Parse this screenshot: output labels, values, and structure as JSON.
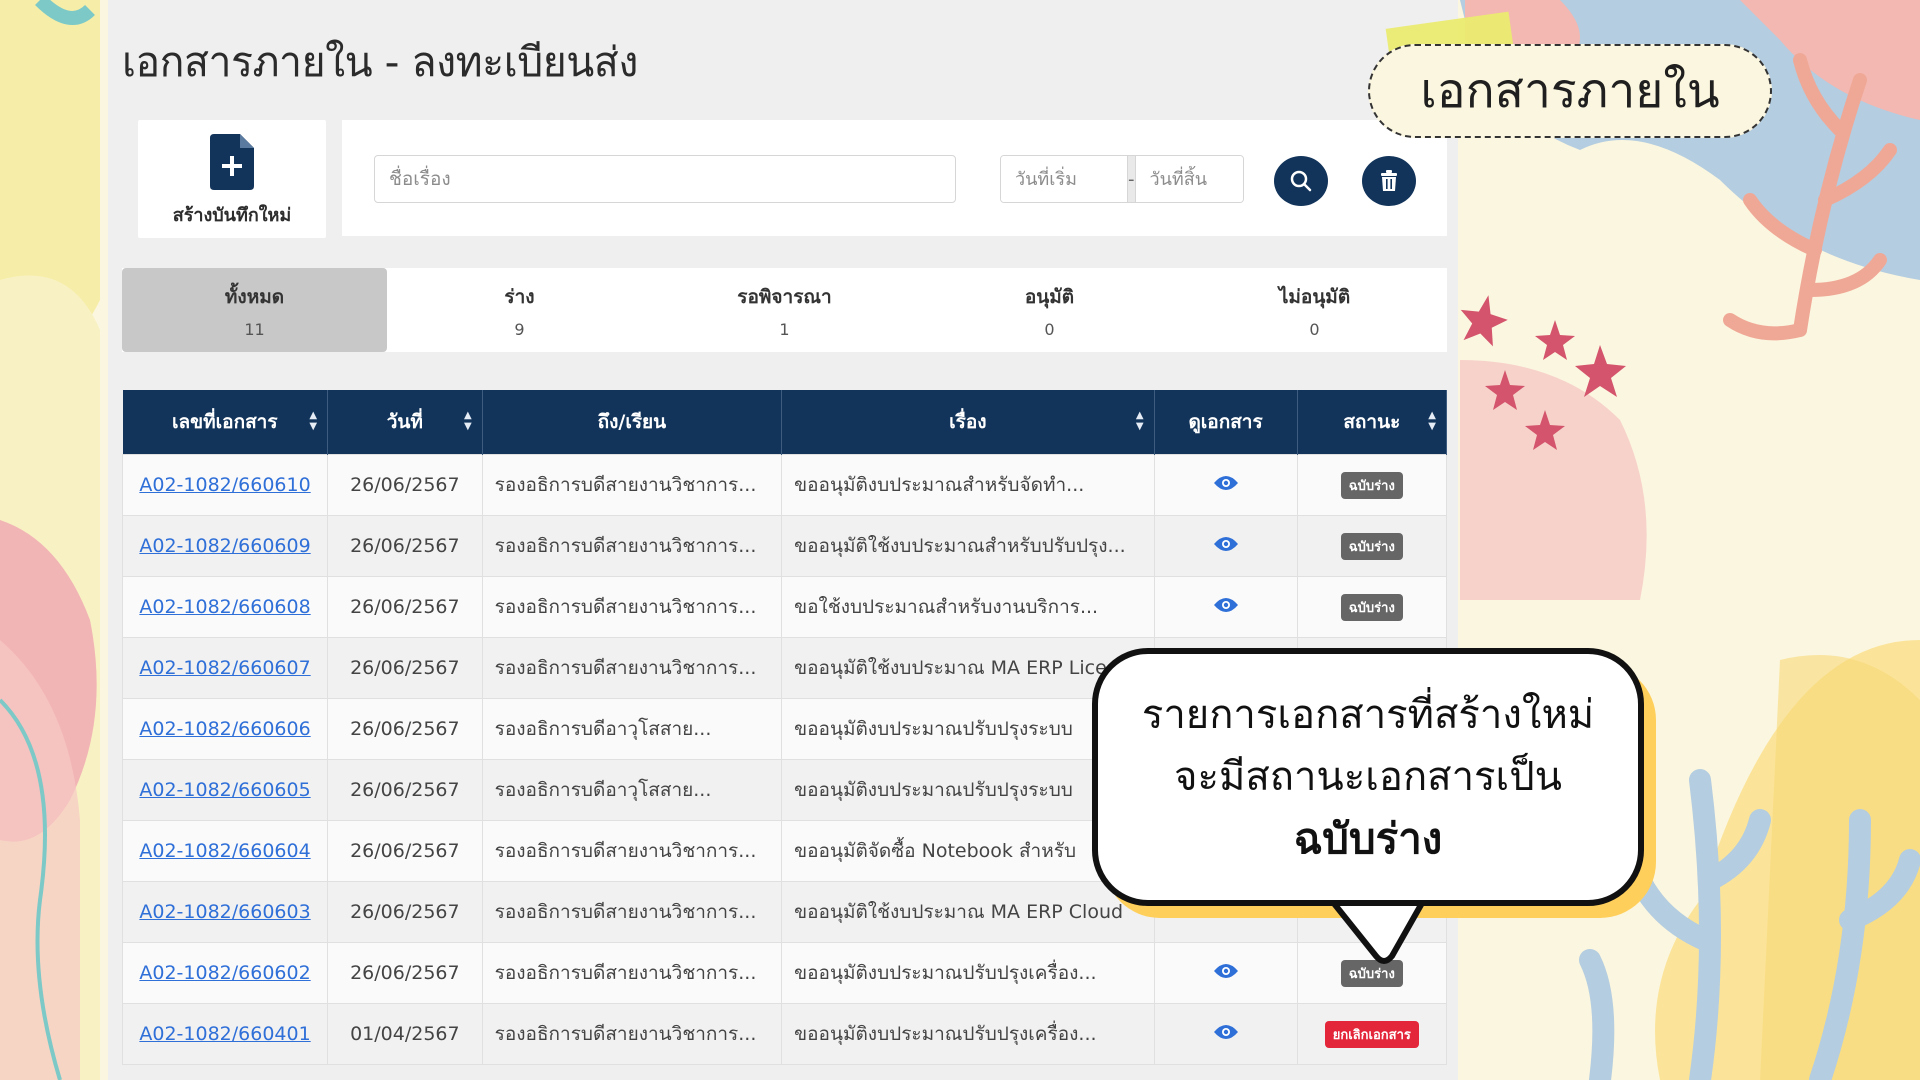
{
  "page_title": "เอกสารภายใน - ลงทะเบียนส่ง",
  "header_label": "เอกสารภายใน",
  "new_button": {
    "label": "สร้างบันทึกใหม่"
  },
  "filter": {
    "subject_placeholder": "ชื่อเรื่อง",
    "start_date_placeholder": "วันที่เริ่ม",
    "date_separator": "-",
    "end_date_placeholder": "วันที่สิ้น"
  },
  "tabs": [
    {
      "label": "ทั้งหมด",
      "count": "11"
    },
    {
      "label": "ร่าง",
      "count": "9"
    },
    {
      "label": "รอพิจารณา",
      "count": "1"
    },
    {
      "label": "อนุมัติ",
      "count": "0"
    },
    {
      "label": "ไม่อนุมัติ",
      "count": "0"
    }
  ],
  "table": {
    "headers": [
      "เลขที่เอกสาร",
      "วันที่",
      "ถึง/เรียน",
      "เรื่อง",
      "ดูเอกสาร",
      "สถานะ"
    ],
    "rows": [
      {
        "no": "A02-1082/660610",
        "date": "26/06/2567",
        "to": "รองอธิการบดีสายงานวิชาการ...",
        "subject": "ขออนุมัติงบประมาณสำหรับจัดทำ...",
        "status": "ฉบับร่าง",
        "status_type": "draft"
      },
      {
        "no": "A02-1082/660609",
        "date": "26/06/2567",
        "to": "รองอธิการบดีสายงานวิชาการ...",
        "subject": "ขออนุมัติใช้งบประมาณสำหรับปรับปรุง...",
        "status": "ฉบับร่าง",
        "status_type": "draft"
      },
      {
        "no": "A02-1082/660608",
        "date": "26/06/2567",
        "to": "รองอธิการบดีสายงานวิชาการ...",
        "subject": "ขอใช้งบประมาณสำหรับงานบริการ...",
        "status": "ฉบับร่าง",
        "status_type": "draft"
      },
      {
        "no": "A02-1082/660607",
        "date": "26/06/2567",
        "to": "รองอธิการบดีสายงานวิชาการ...",
        "subject": "ขออนุมัติใช้งบประมาณ MA ERP Lice",
        "status": "",
        "status_type": "hidden"
      },
      {
        "no": "A02-1082/660606",
        "date": "26/06/2567",
        "to": "รองอธิการบดีอาวุโสสาย...",
        "subject": "ขออนุมัติงบประมาณปรับปรุงระบบ",
        "status": "",
        "status_type": "hidden"
      },
      {
        "no": "A02-1082/660605",
        "date": "26/06/2567",
        "to": "รองอธิการบดีอาวุโสสาย...",
        "subject": "ขออนุมัติงบประมาณปรับปรุงระบบ",
        "status": "",
        "status_type": "hidden"
      },
      {
        "no": "A02-1082/660604",
        "date": "26/06/2567",
        "to": "รองอธิการบดีสายงานวิชาการ...",
        "subject": "ขออนุมัติจัดซื้อ Notebook สำหรับ",
        "status": "",
        "status_type": "hidden"
      },
      {
        "no": "A02-1082/660603",
        "date": "26/06/2567",
        "to": "รองอธิการบดีสายงานวิชาการ...",
        "subject": "ขออนุมัติใช้งบประมาณ MA ERP Cloud",
        "status": "",
        "status_type": "hidden"
      },
      {
        "no": "A02-1082/660602",
        "date": "26/06/2567",
        "to": "รองอธิการบดีสายงานวิชาการ...",
        "subject": "ขออนุมัติงบประมาณปรับปรุงเครื่อง...",
        "status": "ฉบับร่าง",
        "status_type": "draft"
      },
      {
        "no": "A02-1082/660401",
        "date": "01/04/2567",
        "to": "รองอธิการบดีสายงานวิชาการ...",
        "subject": "ขออนุมัติงบประมาณปรับปรุงเครื่อง...",
        "status": "ยกเลิกเอกสาร",
        "status_type": "cancel"
      }
    ]
  },
  "callout": {
    "line1": "รายการเอกสารที่สร้างใหม่",
    "line2": "จะมีสถานะเอกสารเป็น",
    "line3": "ฉบับร่าง"
  },
  "icons": {
    "new_doc": "file-plus-icon",
    "search": "search-icon",
    "clear": "trash-icon",
    "view": "eye-icon",
    "sort": "sort-icon"
  },
  "colors": {
    "navy": "#12345a",
    "link": "#2f6fd8",
    "draft_badge": "#666666",
    "cancel_badge": "#e3263a",
    "callout_shadow": "#ffcf5c"
  }
}
